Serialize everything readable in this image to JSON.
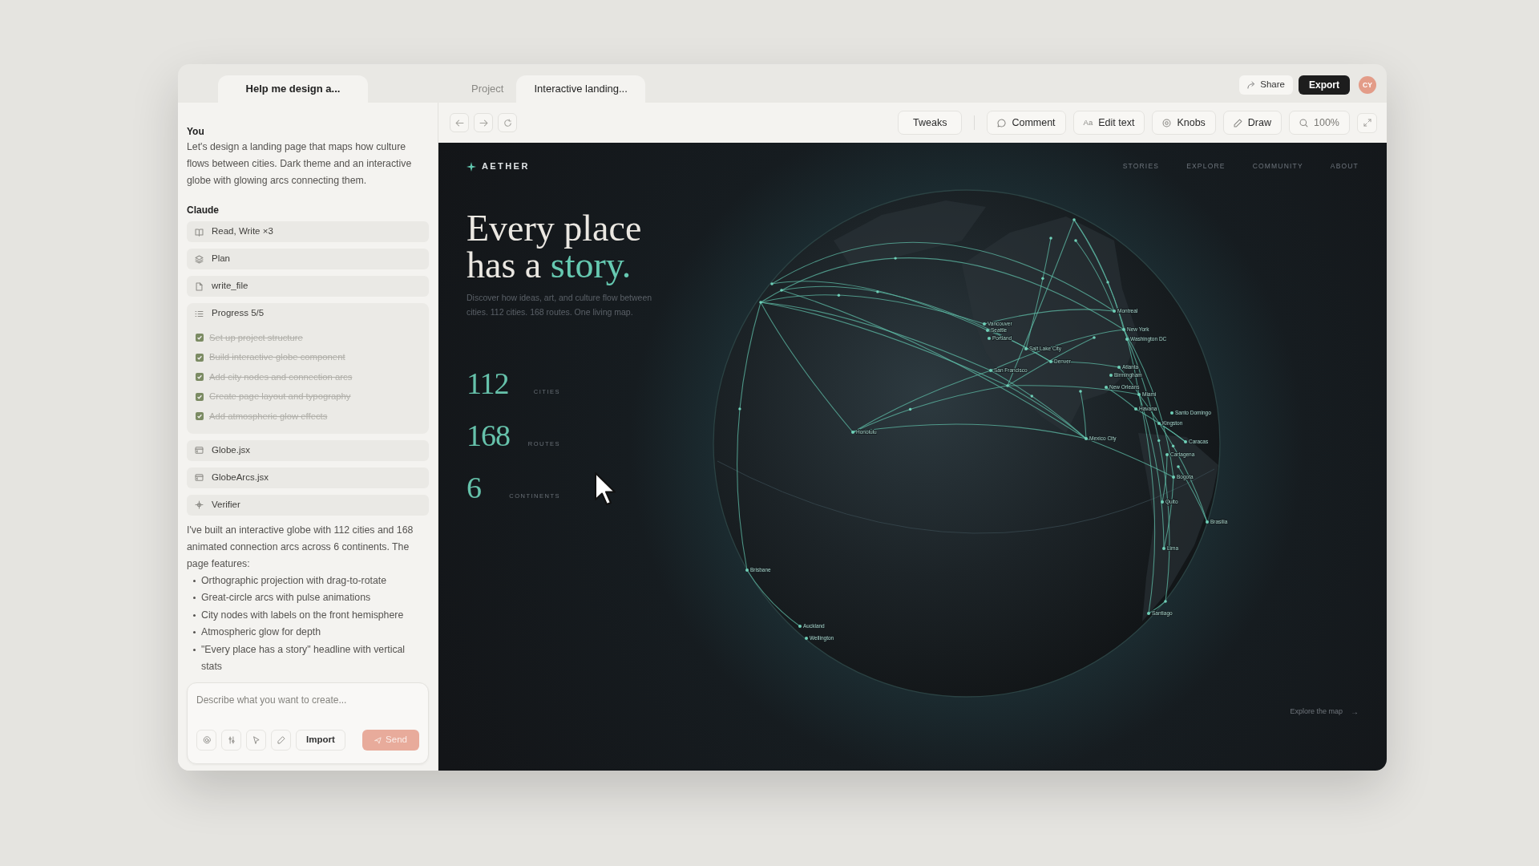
{
  "chat_tab": {
    "title": "Help me design a..."
  },
  "tabs": [
    {
      "label": "Project",
      "selected": false
    },
    {
      "label": "Interactive landing...",
      "selected": true
    }
  ],
  "header": {
    "share": "Share",
    "export": "Export",
    "avatar": "CY"
  },
  "toolbar": {
    "tools": [
      {
        "kind": "tweaks",
        "label": "Tweaks"
      },
      {
        "kind": "comment",
        "label": "Comment"
      },
      {
        "kind": "edit_text",
        "glyph": "Aa",
        "label": "Edit text"
      },
      {
        "kind": "knobs",
        "label": "Knobs"
      },
      {
        "kind": "draw",
        "label": "Draw"
      },
      {
        "kind": "zoom",
        "label": "100%"
      }
    ]
  },
  "chat": {
    "user": {
      "author": "You",
      "text": "Let's design a landing page that maps how culture flows between cities. Dark theme and an interactive globe with glowing arcs connecting them."
    },
    "assistant": {
      "author": "Claude",
      "steps": [
        {
          "kind": "read_write",
          "label": "Read, Write ×3"
        },
        {
          "kind": "plan",
          "label": "Plan"
        },
        {
          "kind": "write_file",
          "label": "write_file"
        },
        {
          "kind": "progress",
          "label": "Progress 5/5",
          "tasks": [
            {
              "label": "Set up project structure",
              "checked": true
            },
            {
              "label": "Build interactive globe component",
              "checked": true
            },
            {
              "label": "Add city nodes and connection arcs",
              "checked": true
            },
            {
              "label": "Create page layout and typography",
              "checked": true
            },
            {
              "label": "Add atmospheric glow effects",
              "checked": true
            }
          ]
        },
        {
          "kind": "file",
          "label": "Globe.jsx"
        },
        {
          "kind": "file",
          "label": "GlobeArcs.jsx"
        },
        {
          "kind": "verifier",
          "label": "Verifier"
        }
      ],
      "reply": "I've built an interactive globe with 112 cities and 168 animated connection arcs across 6 continents. The page features:",
      "bullets": [
        "Orthographic projection with drag-to-rotate",
        "Great-circle arcs with pulse animations",
        "City nodes with labels on the front hemisphere",
        "Atmospheric glow for depth",
        "\"Every place has a story\" headline with vertical stats"
      ]
    }
  },
  "composer": {
    "placeholder": "Describe what you want to create...",
    "import": "Import",
    "send": {
      "label": "Send",
      "disabled": true
    }
  },
  "preview": {
    "brand": "AETHER",
    "nav": [
      "STORIES",
      "EXPLORE",
      "COMMUNITY",
      "ABOUT"
    ],
    "headline": "Every place has a",
    "headline_accent": "story.",
    "description": "Discover how ideas, art, and culture flow between cities. 112 cities. 168 routes. One living map.",
    "stats": [
      {
        "value": "112",
        "label": "CITIES"
      },
      {
        "value": "168",
        "label": "ROUTES"
      },
      {
        "value": "6",
        "label": "CONTINENTS"
      }
    ],
    "explore": {
      "label": "Explore the map",
      "arrow": "→"
    },
    "globe": {
      "cities": [
        "Vancouver",
        "Seattle",
        "Portland",
        "Salt Lake City",
        "Denver",
        "San Francisco",
        "Montreal",
        "New York",
        "Washington DC",
        "Atlanta",
        "Birmingham",
        "New Orleans",
        "Miami",
        "Havana",
        "Santo Domingo",
        "Kingston",
        "Caracas",
        "Cartagena",
        "Mexico City",
        "Bogota",
        "Quito",
        "Brasilia",
        "Lima",
        "Santiago",
        "Honolulu",
        "Auckland",
        "Wellington",
        "Brisbane"
      ]
    }
  }
}
